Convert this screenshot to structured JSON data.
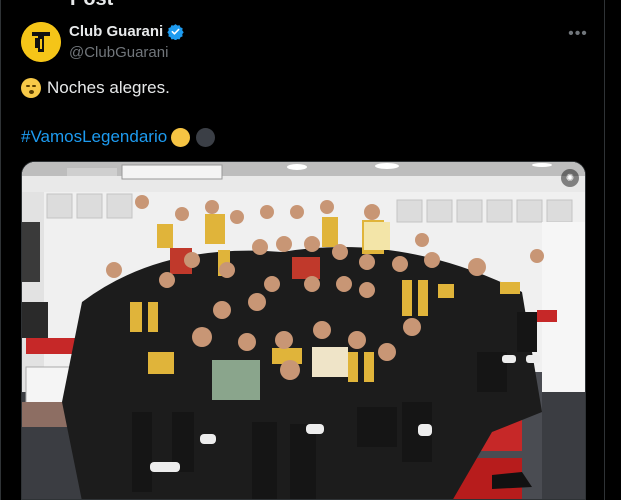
{
  "header": {
    "title": "Post"
  },
  "author": {
    "name": "Club Guarani",
    "handle": "@ClubGuarani",
    "avatar_icon": "club-crest-icon",
    "verified_icon": "verified-badge-icon"
  },
  "menu": {
    "more_icon": "more-horizontal-icon",
    "more_glyph": "•••"
  },
  "tweet": {
    "line1_emoji": "smiling-face-emoji",
    "line1_text": "Noches alegres.",
    "hashtag": "#VamosLegendario",
    "trailing_emojis": [
      "yellow-circle-emoji",
      "black-circle-emoji"
    ]
  },
  "media": {
    "type": "photo",
    "alt_icon": "watermark-icon",
    "description_visible": false
  },
  "colors": {
    "background": "#000000",
    "text": "#e7e9ea",
    "secondary": "#71767b",
    "link": "#1d9bf0",
    "verified": "#1d9bf0",
    "brand_yellow": "#f5c518"
  }
}
